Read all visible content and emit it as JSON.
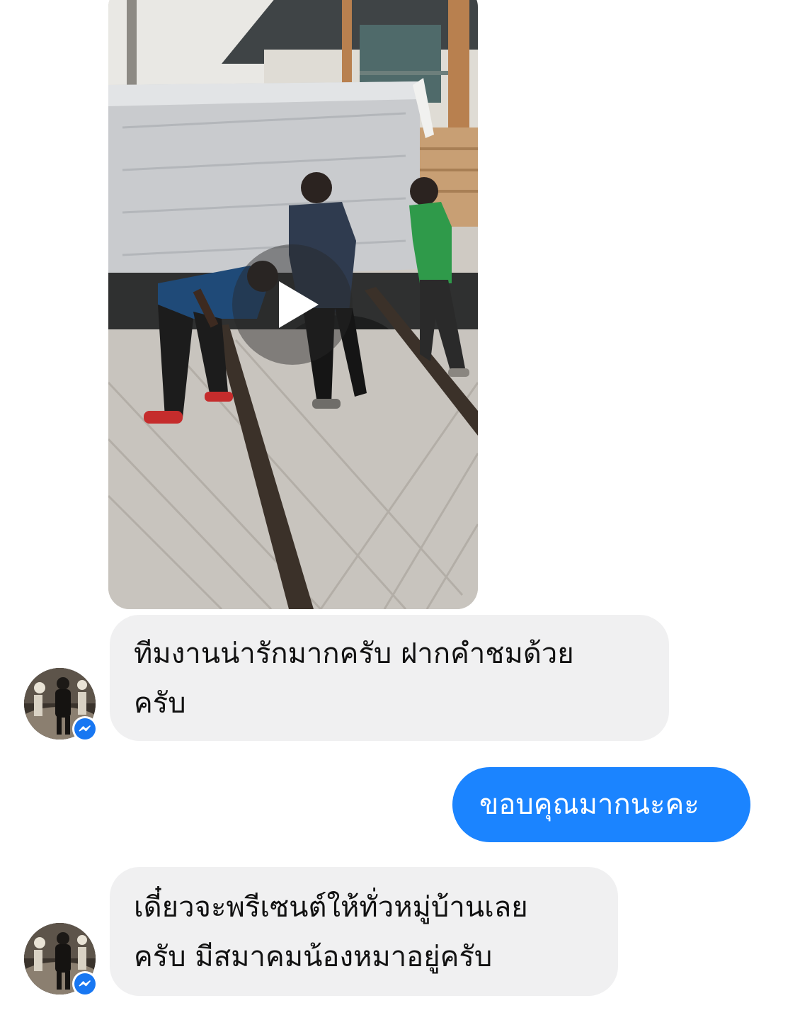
{
  "conversation": {
    "messages": [
      {
        "type": "video",
        "direction": "incoming",
        "icon": "play-icon"
      },
      {
        "type": "text",
        "direction": "incoming",
        "lines": [
          "ทีมงานน่ารักมากครับ ฝากคำชมด้วย",
          "ครับ"
        ]
      },
      {
        "type": "text",
        "direction": "outgoing",
        "lines": [
          "ขอบคุณมากนะคะ"
        ]
      },
      {
        "type": "text",
        "direction": "incoming",
        "lines": [
          "เดี๋ยวจะพรีเซนต์ให้ทั่วหมู่บ้านเลย",
          "ครับ มีสมาคมน้องหมาอยู่ครับ"
        ]
      }
    ],
    "sender_badge_icon": "messenger-icon"
  },
  "colors": {
    "outgoing_bubble": "#1b84ff",
    "incoming_bubble": "#f0f0f1",
    "incoming_text": "#121212",
    "outgoing_text": "#ffffff",
    "messenger_badge": "#1877f2"
  }
}
